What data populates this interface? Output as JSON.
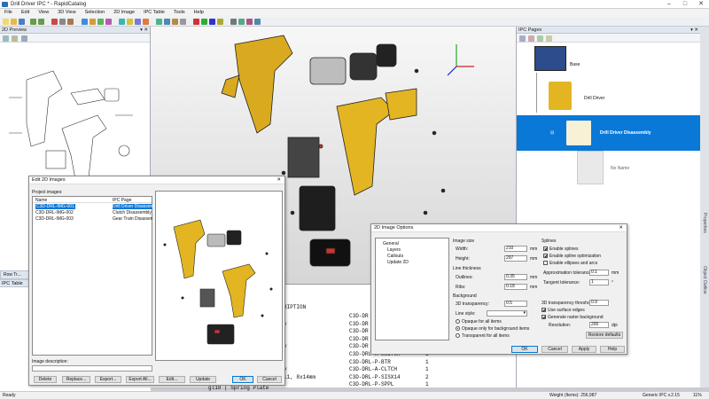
{
  "window": {
    "title": "Drill Driver IPC * - RapidCatalog",
    "min": "–",
    "max": "□",
    "close": "✕"
  },
  "menu": [
    "File",
    "Edit",
    "View",
    "3D View",
    "Selection",
    "2D Image",
    "IPC Table",
    "Tools",
    "Help"
  ],
  "preview_panel": {
    "title": "2D Preview",
    "pin": "▾ ✕"
  },
  "row_tab": {
    "label": "Row Tr..."
  },
  "ipc_table_panel": {
    "title": "IPC Table"
  },
  "ipc_pages": {
    "title": "IPC Pages",
    "nodes": [
      {
        "label": "Base"
      },
      {
        "label": "Drill Driver"
      },
      {
        "label": "Drill Driver Disassembly"
      },
      {
        "label": "No Name"
      }
    ]
  },
  "side_tabs": [
    "Properties",
    "Object Outline"
  ],
  "edit_dialog": {
    "title": "Edit 2D Images",
    "project_images_label": "Project images:",
    "col_name": "Name",
    "col_page": "IPC Page",
    "rows": [
      {
        "name": "C3D-DRL-IMG-001",
        "page": "Drill Driver Disassembly"
      },
      {
        "name": "C3D-DRL-IMG-002",
        "page": "Clutch Disassembly"
      },
      {
        "name": "C3D-DRL-IMG-003",
        "page": "Gear Train Disassembl..."
      }
    ],
    "image_description_label": "Image description:",
    "buttons": {
      "delete": "Delete",
      "replace": "Replace...",
      "export": "Export...",
      "export_all": "Export All...",
      "edit": "Edit...",
      "update": "Update",
      "ok": "OK",
      "cancel": "Cancel"
    },
    "close": "✕"
  },
  "options_dialog": {
    "title": "2D Image Options",
    "close": "✕",
    "tree": [
      "General",
      "Layers",
      "Callouts",
      "Update 2D"
    ],
    "image_size": {
      "label": "Image size",
      "width_label": "Width:",
      "width": "210",
      "height_label": "Height:",
      "height": "297",
      "unit": "mm"
    },
    "line_thickness": {
      "label": "Line thickness",
      "outlines_label": "Outlines:",
      "outlines": "0.35",
      "ribs_label": "Ribs:",
      "ribs": "0.18",
      "unit": "mm"
    },
    "background": {
      "label": "Background",
      "transparency_label": "3D transparency:",
      "transparency": "0.5",
      "line_style_label": "Line style:",
      "options": [
        "Opaque for all items",
        "Opaque only for background items",
        "Transparent for all items"
      ],
      "selected": 1
    },
    "splines": {
      "label": "Splines",
      "enable": "Enable splines",
      "optimization": "Enable spline optimization",
      "ellipses": "Enable ellipses and arcs",
      "approx_label": "Approximation tolerance:",
      "approx": "0.1",
      "tangent_label": "Tangent tolerance:",
      "tangent": "1",
      "approx_unit": "mm",
      "tangent_unit": "°"
    },
    "transparency_threshold_label": "3D transparency threshold:",
    "transparency_threshold": "0.9",
    "use_surface_edges": "Use surface edges",
    "generate_raster": "Generate raster background",
    "resolution_label": "Resolution:",
    "resolution": "200",
    "resolution_unit": "dpi",
    "restore": "Restore defaults",
    "buttons": {
      "ok": "OK",
      "cancel": "Cancel",
      "apply": "Apply",
      "help": "Help"
    }
  },
  "table": {
    "header": "RIPTION",
    "rows": [
      {
        "desc": "",
        "code": "C3D-DR",
        "qty": ""
      },
      {
        "desc": "y",
        "code": "C3D-DR",
        "qty": ""
      },
      {
        "desc": "",
        "code": "C3D-DR",
        "qty": ""
      },
      {
        "desc": "",
        "code": "C3D-DR",
        "qty": ""
      },
      {
        "desc": "y",
        "code": "C3D-DR",
        "qty": ""
      },
      {
        "desc": "",
        "code": "C3D-DRL-A-SWITCH",
        "qty": "1"
      },
      {
        "desc": "",
        "code": "C3D-DRL-P-BTR",
        "qty": "1"
      },
      {
        "desc": "y",
        "code": "C3D-DRL-A-CLTCH",
        "qty": "1"
      },
      {
        "desc": "l1, 8x14mm",
        "code": "C3D-DRL-P-SISX14",
        "qty": "2"
      },
      {
        "desc": "",
        "code": "C3D-DRL-P-SPPL",
        "qty": "1"
      }
    ],
    "footer": "gl10 | Spring Plate"
  },
  "status": {
    "left": "Ready",
    "weight": "Weight (Items): 256,987",
    "ipc": "Generic IPC v.2.15",
    "zoom": "11%"
  }
}
